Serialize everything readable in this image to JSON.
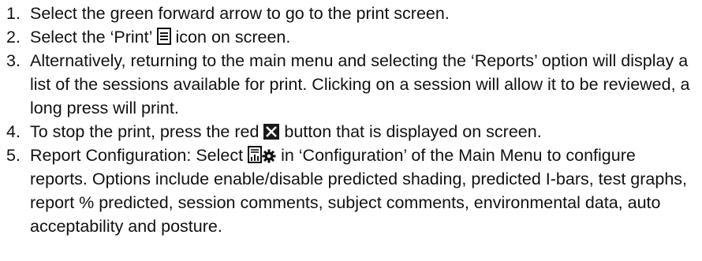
{
  "steps": [
    {
      "number": "1.",
      "text": "Select the green forward arrow to go to the print screen."
    },
    {
      "number": "2.",
      "before": "Select the ‘Print’",
      "after": "icon on screen.",
      "icon": "print-document-icon"
    },
    {
      "number": "3.",
      "text": "Alternatively, returning to the main menu and selecting the ‘Reports’ option will display a list of the sessions available for print. Clicking on a session will allow it to be reviewed, a long press will print."
    },
    {
      "number": "4.",
      "before": "To stop the print, press the red",
      "after": "button that is displayed on screen.",
      "icon": "stop-x-icon",
      "icon_color": "#1a1a1a"
    },
    {
      "number": "5.",
      "before": "Report Configuration: Select",
      "after": "in ‘Configuration’ of the Main Menu to configure reports. Options include enable/disable predicted shading, predicted I-bars, test graphs, report % predicted, session comments, subject comments, environmental data, auto acceptability and posture.",
      "icons": [
        "report-config-icon",
        "gear-icon"
      ]
    }
  ]
}
